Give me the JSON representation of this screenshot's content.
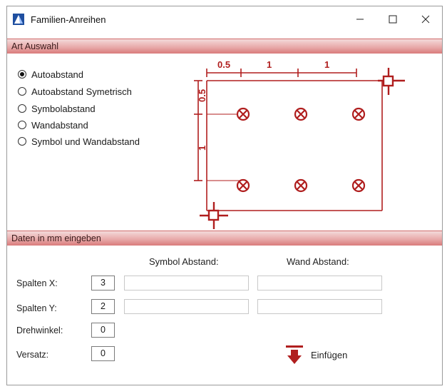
{
  "window": {
    "title": "Familien-Anreihen",
    "controls": {
      "minimize": "—",
      "maximize": "☐",
      "close": "✕"
    }
  },
  "section_type": {
    "title": "Art Auswahl",
    "options": [
      {
        "label": "Autoabstand",
        "checked": true
      },
      {
        "label": "Autoabstand Symetrisch",
        "checked": false
      },
      {
        "label": "Symbolabstand",
        "checked": false
      },
      {
        "label": "Wandabstand",
        "checked": false
      },
      {
        "label": "Symbol und Wandabstand",
        "checked": false
      }
    ]
  },
  "diagram": {
    "color": "#b01e1e",
    "dim_top_first": "0.5",
    "dim_top_second": "1",
    "dim_top_third": "1",
    "dim_left_top": "0.5",
    "dim_left_bottom": "1"
  },
  "section_data": {
    "title": "Daten in mm eingeben",
    "headers": {
      "symbol": "Symbol Abstand:",
      "wall": "Wand Abstand:"
    },
    "rows": {
      "cols_x": {
        "label": "Spalten X:",
        "value": "3"
      },
      "rows_y": {
        "label": "Spalten Y:",
        "value": "2"
      },
      "rotation": {
        "label": "Drehwinkel:",
        "value": "0"
      },
      "offset": {
        "label": "Versatz:",
        "value": "0"
      }
    },
    "insert_label": "Einfügen"
  },
  "colors": {
    "accent": "#b01e1e",
    "bar": "#e7a6a6"
  }
}
